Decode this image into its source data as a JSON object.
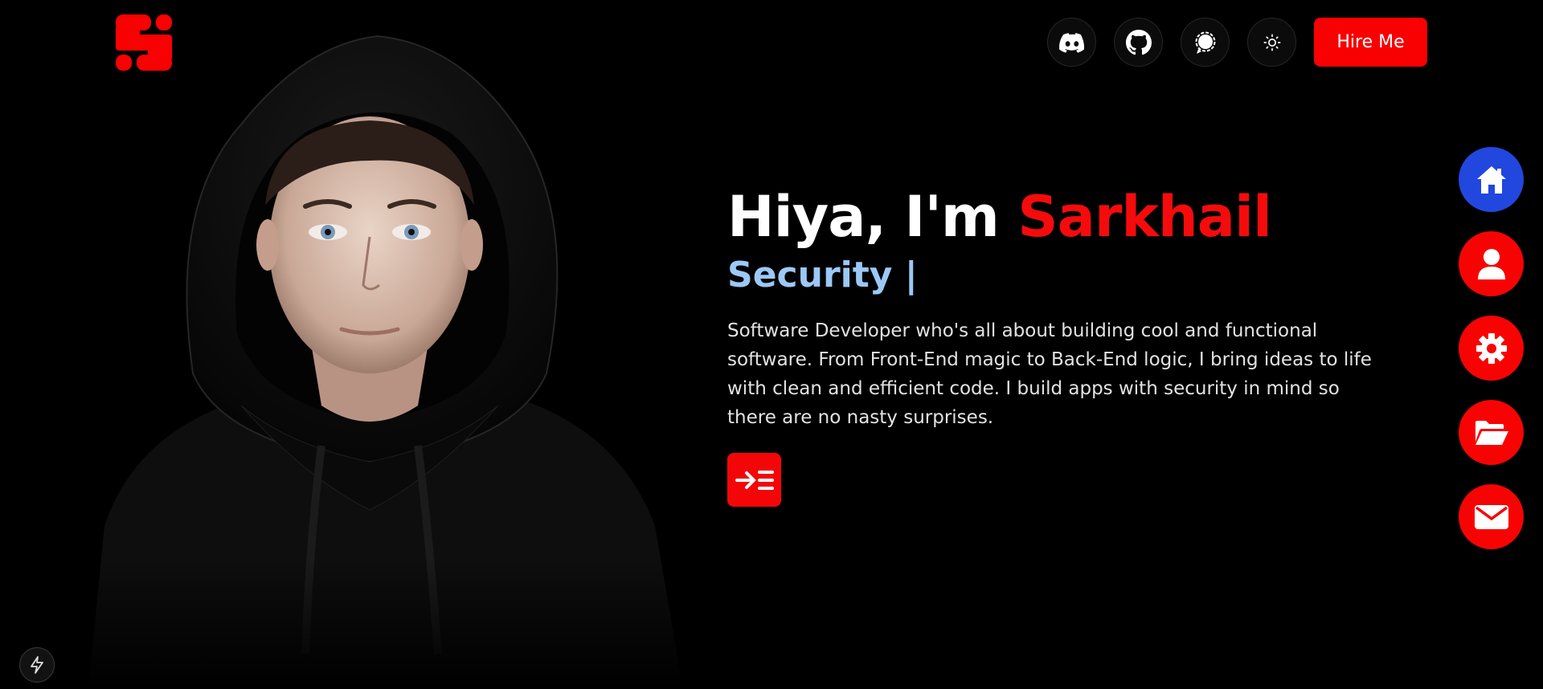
{
  "brand": {
    "logo_icon": "s-logo-icon",
    "accent_color": "#f90002"
  },
  "header": {
    "social": [
      {
        "name": "discord-icon"
      },
      {
        "name": "github-icon"
      },
      {
        "name": "signal-icon"
      },
      {
        "name": "sun-icon"
      }
    ],
    "hire_label": "Hire Me"
  },
  "hero": {
    "greeting": "Hiya, I'm ",
    "name": "Sarkhail",
    "role": "Security |",
    "description": "Software Developer who's all about building cool and functional software. From Front-End magic to Back-End logic, I bring ideas to life with clean and efficient code. I build apps with security in mind so there are no nasty surprises.",
    "cta_icon": "arrow-right-list-icon"
  },
  "side_nav": [
    {
      "icon": "home-icon",
      "active": true
    },
    {
      "icon": "user-icon",
      "active": false
    },
    {
      "icon": "gear-icon",
      "active": false
    },
    {
      "icon": "folder-open-icon",
      "active": false
    },
    {
      "icon": "envelope-icon",
      "active": false
    }
  ],
  "colors": {
    "active_nav": "#2147de",
    "name": "#f50b0b",
    "role": "#9cc8f5"
  }
}
